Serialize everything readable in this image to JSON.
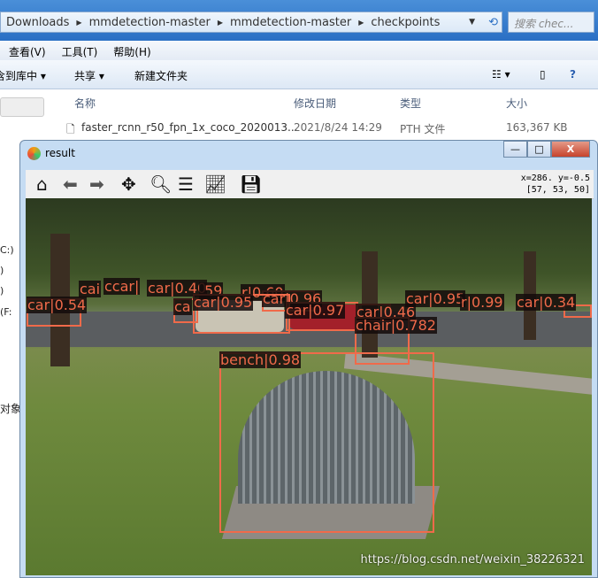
{
  "explorer": {
    "breadcrumb": [
      "Downloads",
      "mmdetection-master",
      "mmdetection-master",
      "checkpoints"
    ],
    "search_placeholder": "搜索 chec...",
    "menu": [
      "查看(V)",
      "工具(T)",
      "帮助(H)"
    ],
    "commands": [
      "含到库中 ▾",
      "共享 ▾",
      "新建文件夹"
    ],
    "columns": [
      "名称",
      "修改日期",
      "类型",
      "大小"
    ],
    "file": {
      "name": "faster_rcnn_r50_fpn_1x_coco_2020013...",
      "modified": "2021/8/24 14:29",
      "type": "PTH 文件",
      "size": "163,367 KB"
    },
    "sidebar_fragments": [
      "C:)",
      ")",
      ")",
      "(F:",
      "对象"
    ]
  },
  "figure": {
    "title": "result",
    "coords_line1": "x=286. y=-0.5",
    "coords_line2": "[57, 53, 50]",
    "tools": [
      "home-icon",
      "back-icon",
      "forward-icon",
      "pan-icon",
      "zoom-icon",
      "configure-subplots-icon",
      "edit-axis-icon",
      "save-icon"
    ],
    "detections": [
      {
        "label": "car|0.54"
      },
      {
        "label": "cai"
      },
      {
        "label": "ccar|"
      },
      {
        "label": "car|0.40"
      },
      {
        "label": ".59"
      },
      {
        "label": "r|0.60"
      },
      {
        "label": "car|0.96"
      },
      {
        "label": "ca"
      },
      {
        "label": "car|0.95"
      },
      {
        "label": "car|0.97"
      },
      {
        "label": "car|0.46"
      },
      {
        "label": "chair|0.782"
      },
      {
        "label": "car|0.95"
      },
      {
        "label": "r|0.99"
      },
      {
        "label": "car|0.34"
      },
      {
        "label": "bench|0.98"
      }
    ],
    "box_color": "#f06a4a"
  },
  "watermark": "https://blog.csdn.net/weixin_38226321"
}
